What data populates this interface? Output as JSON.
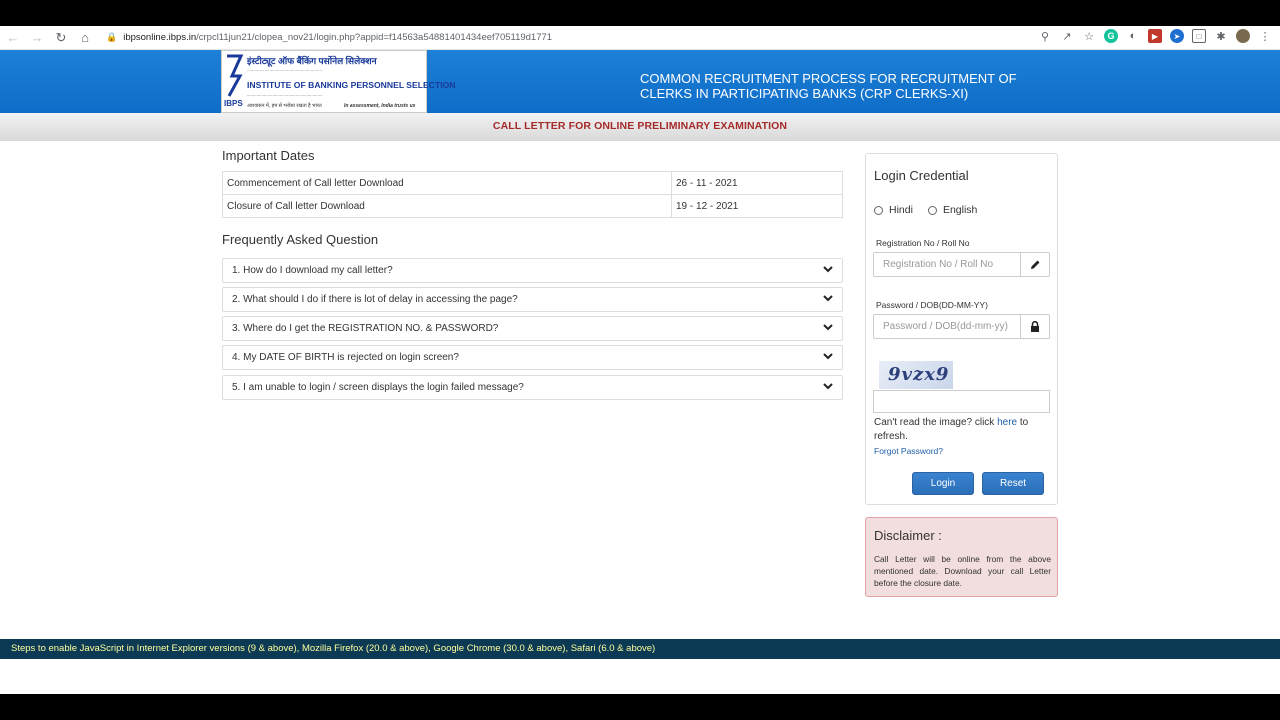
{
  "browser": {
    "url_host": "ibpsonline.ibps.in",
    "url_path": "/crpcl11jun21/clopea_nov21/login.php?appid=f14563a54881401434eef705119d1771"
  },
  "header": {
    "logo_hindi": "इंस्टीट्यूट ऑफ बैंकिंग पर्सोनेल सिलेक्शन",
    "logo_name": "INSTITUTE OF BANKING PERSONNEL SELECTION",
    "logo_ibps": "IBPS",
    "logo_motto_hi": "आश्वासन में, हम से भरोसा रखता है भारत",
    "logo_motto_en": "In assessment, India trusts us",
    "title_line1": "COMMON RECRUITMENT PROCESS FOR RECRUITMENT OF",
    "title_line2": "CLERKS IN PARTICIPATING BANKS (CRP CLERKS-XI)",
    "subheader": "CALL LETTER FOR ONLINE PRELIMINARY EXAMINATION"
  },
  "important_dates": {
    "title": "Important Dates",
    "rows": [
      {
        "label": "Commencement of Call letter Download",
        "value": "26 - 11 - 2021"
      },
      {
        "label": "Closure of Call letter Download",
        "value": "19 - 12 - 2021"
      }
    ]
  },
  "faq": {
    "title": "Frequently Asked Question",
    "items": [
      "1. How do I download my call letter?",
      "2. What should I do if there is lot of delay in accessing the page?",
      "3. Where do I get the REGISTRATION NO. & PASSWORD?",
      "4. My DATE OF BIRTH is rejected on login screen?",
      "5. I am unable to login / screen displays the login failed message?"
    ]
  },
  "login": {
    "title": "Login Credential",
    "lang_hindi": "Hindi",
    "lang_english": "English",
    "reg_label": "Registration No / Roll No",
    "reg_placeholder": "Registration No / Roll No",
    "pwd_label": "Password / DOB(DD-MM-YY)",
    "pwd_placeholder": "Password / DOB(dd-mm-yy)",
    "captcha_text": "9vzx9",
    "cant_read_prefix": "Can't read the image? click ",
    "cant_read_link": "here",
    "cant_read_suffix": " to refresh.",
    "forgot": "Forgot Password?",
    "login_btn": "Login",
    "reset_btn": "Reset"
  },
  "disclaimer": {
    "title": "Disclaimer :",
    "body": "Call Letter will be online from the above mentioned date. Download your call Letter before the closure date."
  },
  "footer": {
    "text": "Steps to enable JavaScript in Internet Explorer versions (9 & above), Mozilla Firefox (20.0 & above), Google Chrome (30.0 & above), Safari (6.0 & above)"
  },
  "colors": {
    "header_blue": "#1478d2",
    "subheader_text": "#a52a2a",
    "button_blue": "#2f77c4",
    "footer_bg": "#0c3a55",
    "footer_text": "#ffff9e",
    "disclaimer_bg": "#f2dede"
  }
}
